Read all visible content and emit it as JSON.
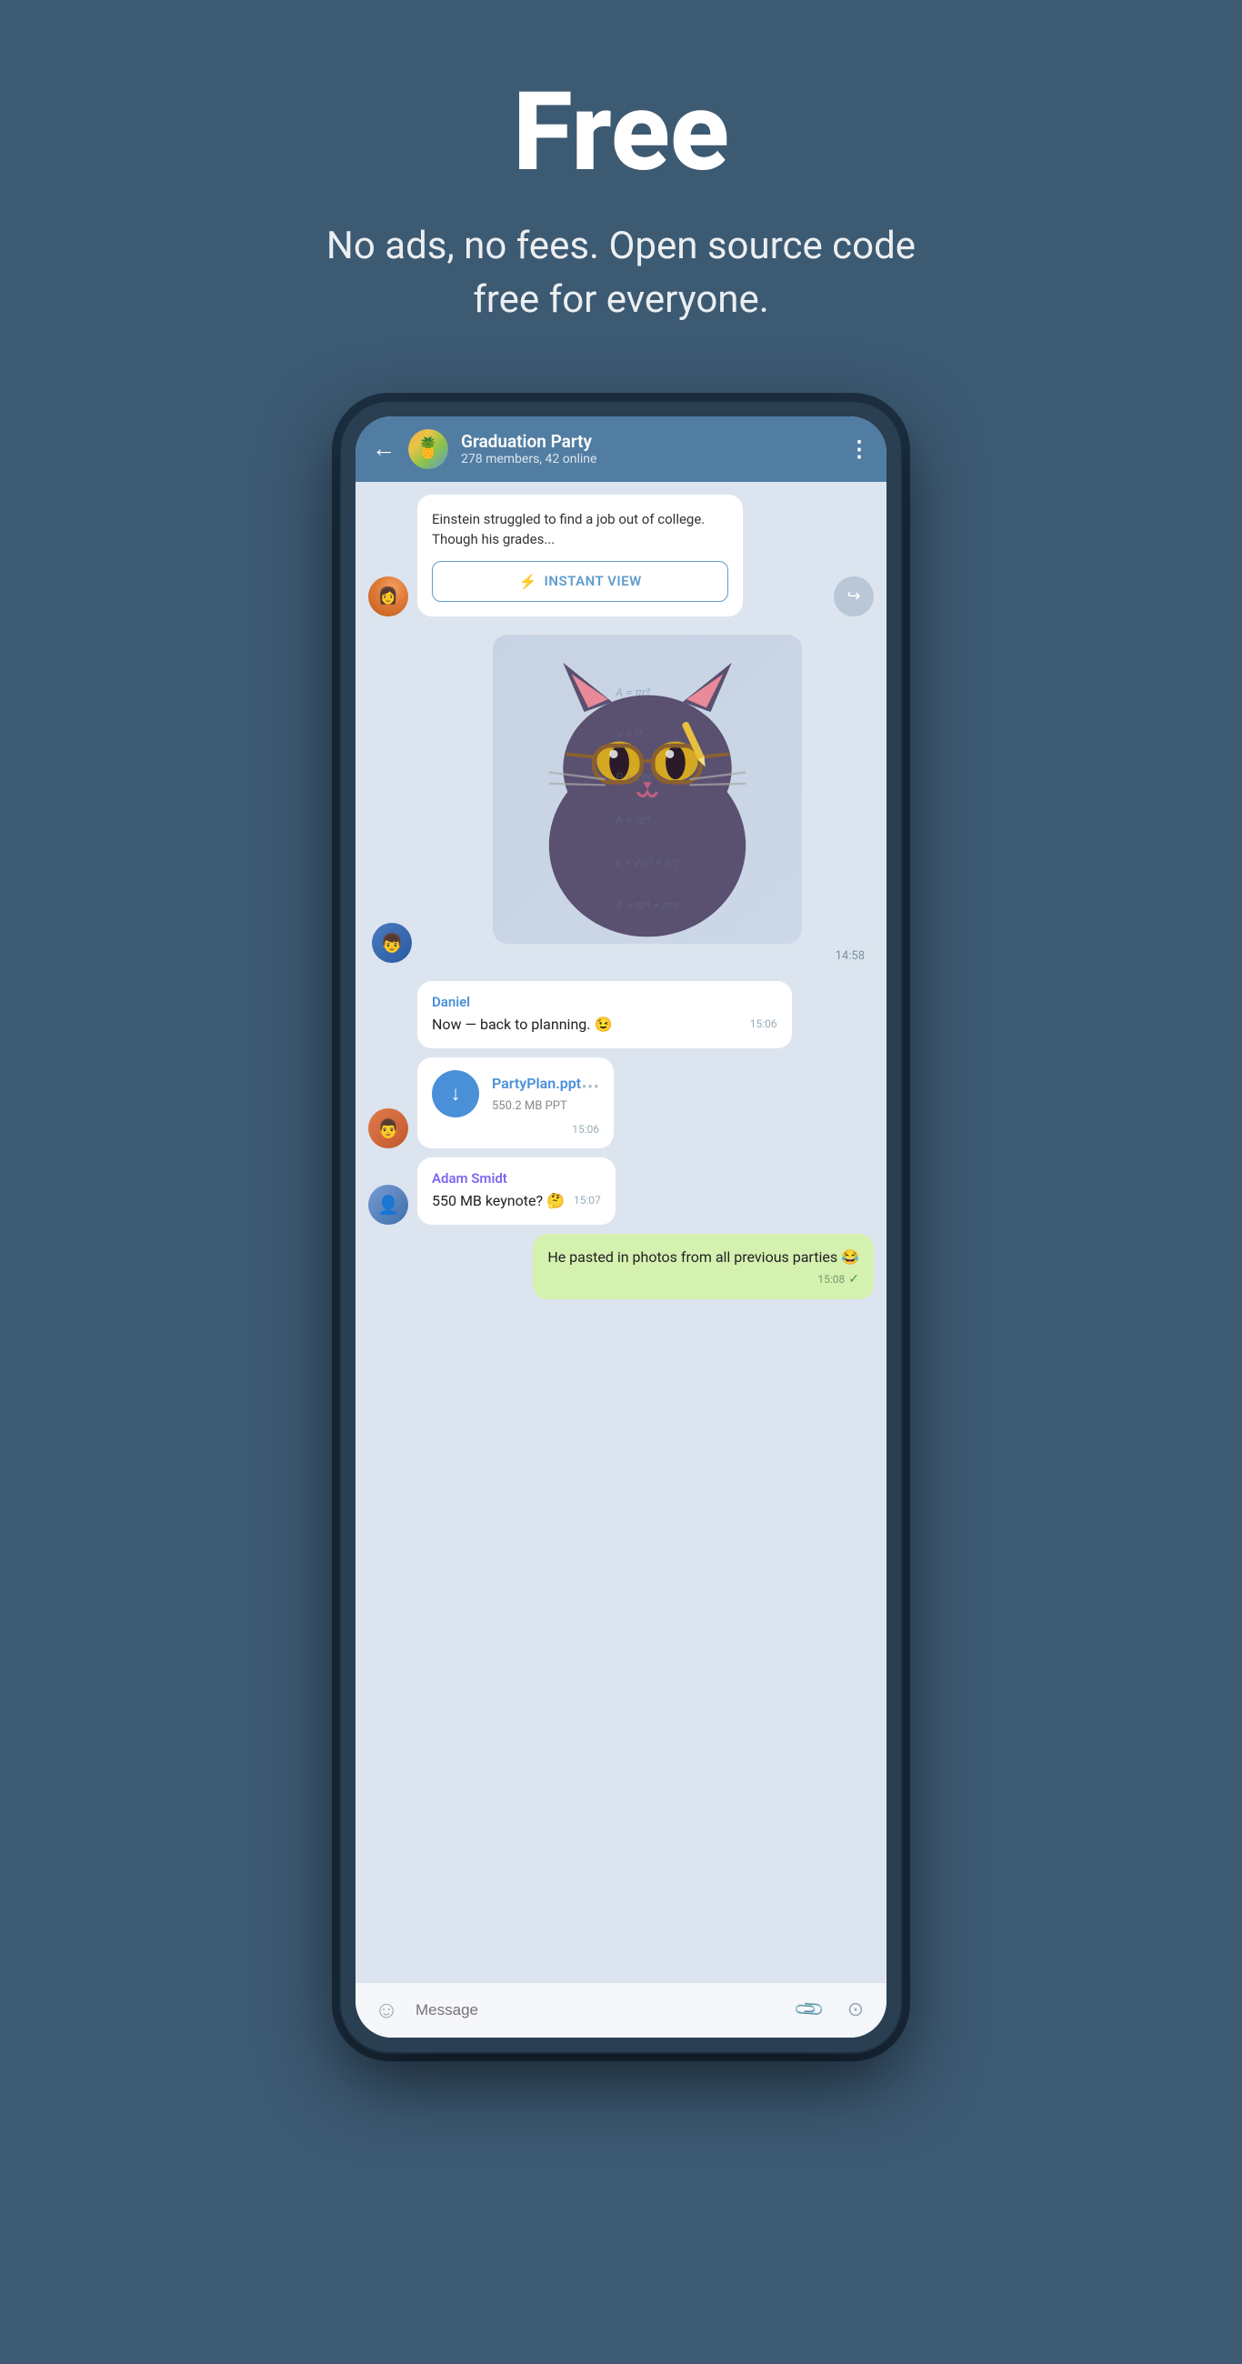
{
  "page": {
    "background_color": "#3d5a73"
  },
  "hero": {
    "title": "Free",
    "subtitle": "No ads, no fees. Open source code free for everyone."
  },
  "chat": {
    "header": {
      "group_name": "Graduation Party",
      "members_info": "278 members, 42 online",
      "back_label": "←",
      "more_label": "⋮"
    },
    "link_message": {
      "text": "Einstein struggled to find a job out of college. Though his grades...",
      "instant_view_label": "INSTANT VIEW",
      "instant_view_icon": "⚡"
    },
    "sticker": {
      "time": "14:58"
    },
    "daniel_message": {
      "sender": "Daniel",
      "text": "Now — back to planning. 😉",
      "time": "15:06"
    },
    "file_message": {
      "file_name": "PartyPlan.ppt",
      "file_size": "550.2 MB PPT",
      "time": "15:06"
    },
    "adam_message": {
      "sender": "Adam Smidt",
      "text": "550 MB keynote? 🤔",
      "time": "15:07"
    },
    "self_message": {
      "text": "He pasted in photos from all previous parties 😂",
      "time": "15:08",
      "check": "✓"
    },
    "input": {
      "placeholder": "Message"
    },
    "math_background": "A = πr²\nV = l³\nP = 2πr\nA = πr²\ns = √(r² + h²)\nA = πr² + πrs"
  }
}
